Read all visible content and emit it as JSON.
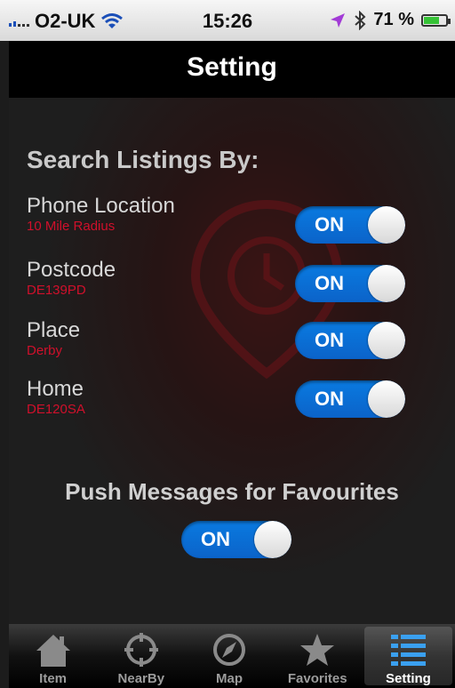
{
  "status_bar": {
    "carrier": "O2-UK",
    "time": "15:26",
    "battery_text": "71 %",
    "battery_level": 0.71,
    "icons": [
      "signal-icon",
      "wifi-icon",
      "location-arrow-icon",
      "bluetooth-icon",
      "battery-icon"
    ]
  },
  "nav": {
    "title": "Setting"
  },
  "search": {
    "title": "Search Listings By:",
    "rows": [
      {
        "label": "Phone Location",
        "sub": "10 Mile Radius",
        "toggle": "ON"
      },
      {
        "label": "Postcode",
        "sub": "DE139PD",
        "toggle": "ON"
      },
      {
        "label": "Place",
        "sub": "Derby",
        "toggle": "ON"
      },
      {
        "label": "Home",
        "sub": "DE120SA",
        "toggle": "ON"
      }
    ]
  },
  "push": {
    "title": "Push Messages for Favourites",
    "toggle": "ON"
  },
  "tabs": [
    {
      "label": "Item",
      "icon": "house-icon"
    },
    {
      "label": "NearBy",
      "icon": "crosshair-icon"
    },
    {
      "label": "Map",
      "icon": "compass-icon"
    },
    {
      "label": "Favorites",
      "icon": "star-icon"
    },
    {
      "label": "Setting",
      "icon": "list-icon",
      "active": true
    }
  ],
  "colors": {
    "toggle_on": "#0b72d9",
    "subtitle": "#d0102b",
    "battery": "#36c236",
    "location_arrow": "#a23bd6"
  }
}
